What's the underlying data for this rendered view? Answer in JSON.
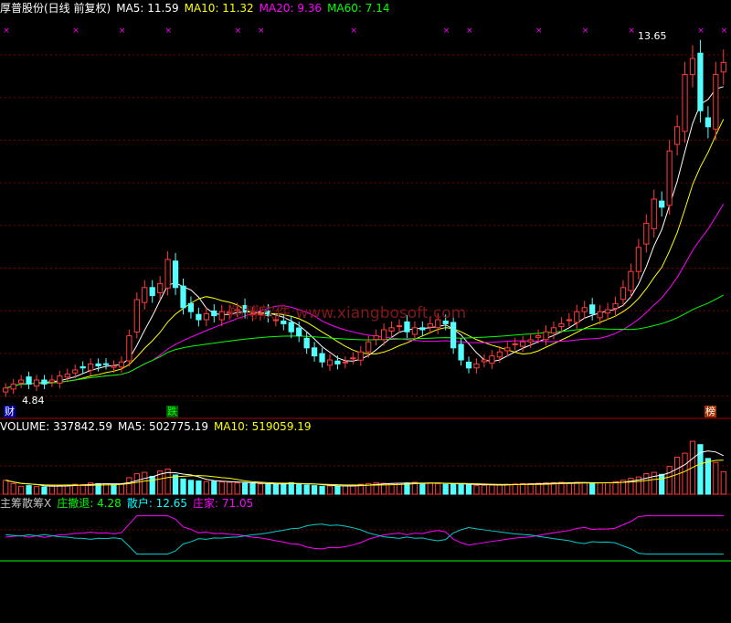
{
  "price_panel": {
    "title": "厚普股份(日线 前复权)",
    "indicators": [
      {
        "label": "MA5: 11.59",
        "color": "#ffffff"
      },
      {
        "label": "MA10: 11.32",
        "color": "#ffff00"
      },
      {
        "label": "MA20: 9.36",
        "color": "#ff00ff"
      },
      {
        "label": "MA60: 7.14",
        "color": "#00ff00"
      }
    ],
    "high_label": "13.65",
    "low_label": "4.84",
    "watermark": "翔博软件 www.xiangbosoft.com",
    "markers": [
      {
        "text": "财",
        "color": "#ffffff",
        "bg": "#0000a0"
      },
      {
        "text": "跌",
        "color": "#00ff00",
        "bg": "#006000"
      },
      {
        "text": "榜",
        "color": "#ffffff",
        "bg": "#a03000"
      }
    ]
  },
  "volume_panel": {
    "indicators": [
      {
        "label": "VOLUME: 337842.59",
        "color": "#ffffff"
      },
      {
        "label": "MA5: 502775.19",
        "color": "#ffffff"
      },
      {
        "label": "MA10: 519059.19",
        "color": "#ffff00"
      }
    ]
  },
  "chip_panel": {
    "title": "主筹散筹X",
    "indicators": [
      {
        "label": "庄撤退: 4.28",
        "color": "#00ff00"
      },
      {
        "label": "散户: 12.65",
        "color": "#00ffff"
      },
      {
        "label": "庄家: 71.05",
        "color": "#ff00ff"
      }
    ]
  },
  "chart_data": {
    "type": "candlestick",
    "close": [
      4.9,
      5.0,
      5.1,
      5.0,
      5.1,
      5.0,
      5.1,
      5.2,
      5.25,
      5.35,
      5.4,
      5.5,
      5.45,
      5.5,
      5.45,
      5.55,
      6.2,
      7.1,
      7.4,
      7.2,
      7.5,
      8.1,
      7.4,
      6.9,
      6.8,
      6.6,
      6.75,
      6.7,
      6.8,
      6.8,
      6.85,
      6.8,
      6.75,
      6.75,
      6.7,
      6.6,
      6.5,
      6.3,
      6.2,
      5.9,
      5.7,
      5.55,
      5.6,
      5.5,
      5.55,
      5.65,
      5.8,
      6.05,
      6.2,
      6.35,
      6.4,
      6.45,
      6.3,
      6.4,
      6.35,
      6.5,
      6.6,
      6.5,
      5.9,
      5.6,
      5.4,
      5.5,
      5.6,
      5.7,
      5.8,
      5.9,
      6.0,
      6.05,
      6.1,
      6.2,
      6.3,
      6.4,
      6.5,
      6.6,
      6.8,
      6.9,
      6.75,
      6.8,
      6.85,
      7.0,
      7.4,
      7.8,
      8.4,
      9.0,
      9.6,
      9.4,
      10.8,
      11.4,
      12.7,
      13.1,
      11.8,
      11.4,
      12.7,
      13.0
    ],
    "volume": [
      210,
      160,
      120,
      130,
      115,
      110,
      125,
      130,
      140,
      150,
      145,
      170,
      160,
      160,
      150,
      155,
      250,
      310,
      330,
      270,
      350,
      380,
      290,
      230,
      210,
      200,
      190,
      195,
      185,
      180,
      170,
      165,
      160,
      155,
      150,
      145,
      165,
      175,
      160,
      140,
      130,
      120,
      125,
      120,
      125,
      130,
      150,
      160,
      175,
      165,
      160,
      165,
      170,
      180,
      165,
      170,
      160,
      150,
      150,
      160,
      140,
      130,
      135,
      140,
      145,
      150,
      155,
      160,
      160,
      165,
      170,
      175,
      180,
      170,
      180,
      175,
      165,
      170,
      175,
      190,
      210,
      240,
      260,
      310,
      330,
      300,
      420,
      560,
      620,
      800,
      750,
      540,
      480,
      340
    ],
    "ma_labels": [
      "MA5",
      "MA10",
      "MA20",
      "MA60"
    ],
    "ma_colors": [
      "#ffffff",
      "#ffff00",
      "#ff00ff",
      "#00ff00"
    ],
    "price_range": [
      4.6,
      14.1
    ],
    "volume_max": 870,
    "grid": true
  }
}
